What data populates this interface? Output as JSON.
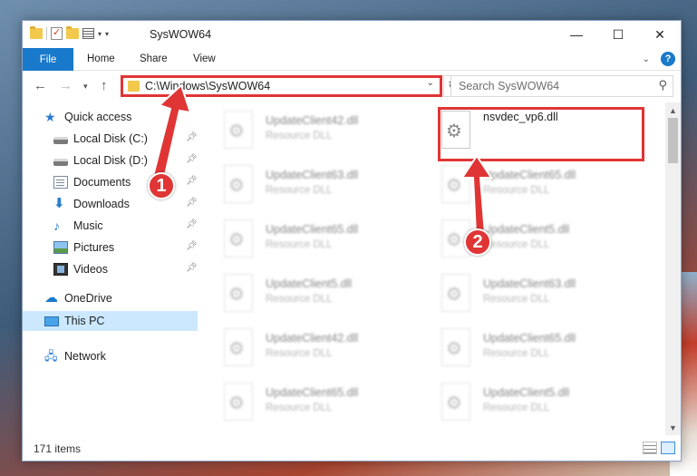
{
  "window": {
    "title": "SysWOW64",
    "controls": {
      "minimize": "—",
      "maximize": "☐",
      "close": "✕"
    }
  },
  "ribbon": {
    "tabs": [
      {
        "label": "File"
      },
      {
        "label": "Home"
      },
      {
        "label": "Share"
      },
      {
        "label": "View"
      }
    ],
    "help": "?"
  },
  "navigation": {
    "address": "C:\\Windows\\SysWOW64",
    "search_placeholder": "Search SysWOW64"
  },
  "sidebar": {
    "items": [
      {
        "label": "Quick access",
        "icon": "star-icon",
        "pinned": false
      },
      {
        "label": "Local Disk (C:)",
        "icon": "disk-icon",
        "pinned": true
      },
      {
        "label": "Local Disk (D:)",
        "icon": "disk-icon",
        "pinned": true
      },
      {
        "label": "Documents",
        "icon": "documents-icon",
        "pinned": true
      },
      {
        "label": "Downloads",
        "icon": "download-icon",
        "pinned": true
      },
      {
        "label": "Music",
        "icon": "music-icon",
        "pinned": true
      },
      {
        "label": "Pictures",
        "icon": "pictures-icon",
        "pinned": true
      },
      {
        "label": "Videos",
        "icon": "videos-icon",
        "pinned": true
      },
      {
        "label": "OneDrive",
        "icon": "cloud-icon",
        "pinned": false
      },
      {
        "label": "This PC",
        "icon": "pc-icon",
        "pinned": false,
        "selected": true
      },
      {
        "label": "Network",
        "icon": "network-icon",
        "pinned": false
      }
    ]
  },
  "files": {
    "left_column": [
      {
        "name": "UpdateClient42.dll",
        "type": "Resource DLL"
      },
      {
        "name": "UpdateClient63.dll",
        "type": "Resource DLL"
      },
      {
        "name": "UpdateClient65.dll",
        "type": "Resource DLL"
      },
      {
        "name": "UpdateClient5.dll",
        "type": "Resource DLL"
      },
      {
        "name": "UpdateClient42.dll",
        "type": "Resource DLL"
      },
      {
        "name": "UpdateClient65.dll",
        "type": "Resource DLL"
      }
    ],
    "right_column": [
      {
        "name": "nsvdec_vp6.dll",
        "type": ""
      },
      {
        "name": "UpdateClient65.dll",
        "type": "Resource DLL"
      },
      {
        "name": "UpdateClient5.dll",
        "type": "Resource DLL"
      },
      {
        "name": "UpdateClient63.dll",
        "type": "Resource DLL"
      },
      {
        "name": "UpdateClient65.dll",
        "type": "Resource DLL"
      },
      {
        "name": "UpdateClient5.dll",
        "type": "Resource DLL"
      }
    ]
  },
  "status": {
    "item_count": "171 items"
  },
  "annotations": {
    "step1": "1",
    "step2": "2",
    "color": "#e03535"
  }
}
